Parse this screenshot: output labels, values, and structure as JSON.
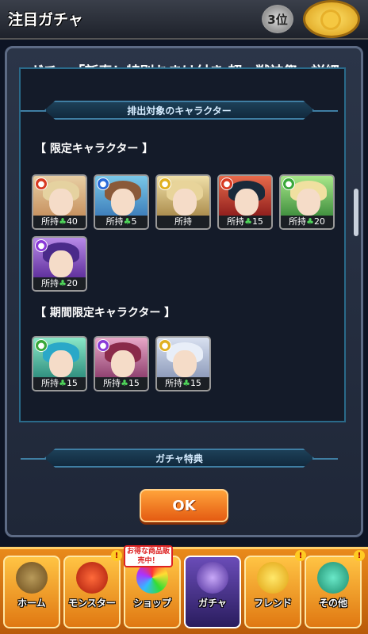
{
  "header": {
    "title": "注目ガチャ",
    "rank": "3位"
  },
  "dialog": {
    "title": "ガチャ「新春！特別おまけ付き 超・獣神祭」詳細",
    "section1_ribbon": "排出対象のキャラクター",
    "limited_label": "【 限定キャラクター 】",
    "period_limited_label": "【 期間限定キャラクター 】",
    "section2_ribbon": "ガチャ特典",
    "ok_label": "OK"
  },
  "limited_characters": [
    {
      "owned": "所持",
      "count": "40",
      "element": "fire",
      "color": "#d83a22"
    },
    {
      "owned": "所持",
      "count": "5",
      "element": "water",
      "color": "#2a6ad8"
    },
    {
      "owned": "所持",
      "count": "",
      "element": "light",
      "color": "#e0b020"
    },
    {
      "owned": "所持",
      "count": "15",
      "element": "fire",
      "color": "#d83a22"
    },
    {
      "owned": "所持",
      "count": "20",
      "element": "wood",
      "color": "#3aa83a"
    },
    {
      "owned": "所持",
      "count": "20",
      "element": "dark",
      "color": "#8a3ad8"
    }
  ],
  "period_limited_characters": [
    {
      "owned": "所持",
      "count": "15",
      "element": "wood",
      "color": "#3aa83a"
    },
    {
      "owned": "所持",
      "count": "15",
      "element": "dark",
      "color": "#8a3ad8"
    },
    {
      "owned": "所持",
      "count": "15",
      "element": "light",
      "color": "#e0b020"
    }
  ],
  "nav": {
    "home": "ホーム",
    "monster": "モンスター",
    "shop": "ショップ",
    "shop_promo": "お得な商品販売中！",
    "gacha": "ガチャ",
    "friend": "フレンド",
    "other": "その他"
  }
}
